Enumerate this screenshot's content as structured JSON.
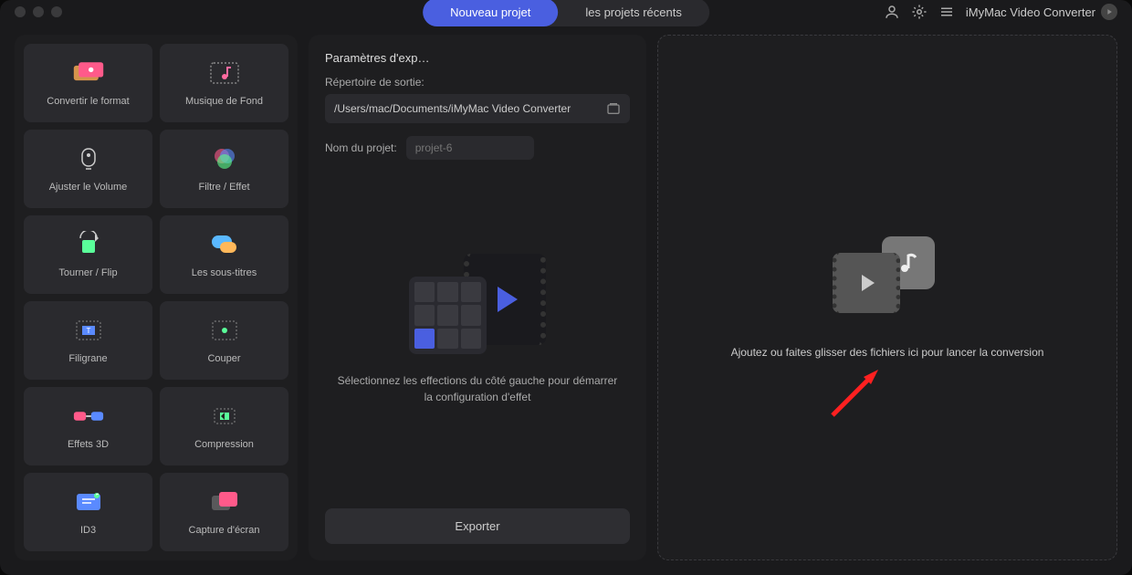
{
  "app_name": "iMyMac Video Converter",
  "tabs": {
    "new": "Nouveau projet",
    "recent": "les projets récents"
  },
  "sidebar": [
    {
      "label": "Convertir le format",
      "name": "tool-convert-format"
    },
    {
      "label": "Musique de Fond",
      "name": "tool-background-music"
    },
    {
      "label": "Ajuster le Volume",
      "name": "tool-adjust-volume"
    },
    {
      "label": "Filtre / Effet",
      "name": "tool-filter-effect"
    },
    {
      "label": "Tourner / Flip",
      "name": "tool-rotate-flip"
    },
    {
      "label": "Les sous-titres",
      "name": "tool-subtitles"
    },
    {
      "label": "Filigrane",
      "name": "tool-watermark"
    },
    {
      "label": "Couper",
      "name": "tool-cut"
    },
    {
      "label": "Effets 3D",
      "name": "tool-3d-effects"
    },
    {
      "label": "Compression",
      "name": "tool-compression"
    },
    {
      "label": "ID3",
      "name": "tool-id3"
    },
    {
      "label": "Capture d'écran",
      "name": "tool-screenshot"
    }
  ],
  "export": {
    "title": "Paramètres d'exp…",
    "dir_label": "Répertoire de sortie:",
    "dir_value": "/Users/mac/Documents/iMyMac Video Converter",
    "name_label": "Nom du projet:",
    "name_placeholder": "projet-6",
    "hint": "Sélectionnez les effections du côté gauche pour démarrer la configuration d'effet",
    "button": "Exporter"
  },
  "drop_hint": "Ajoutez ou faites glisser des fichiers ici pour lancer la conversion"
}
